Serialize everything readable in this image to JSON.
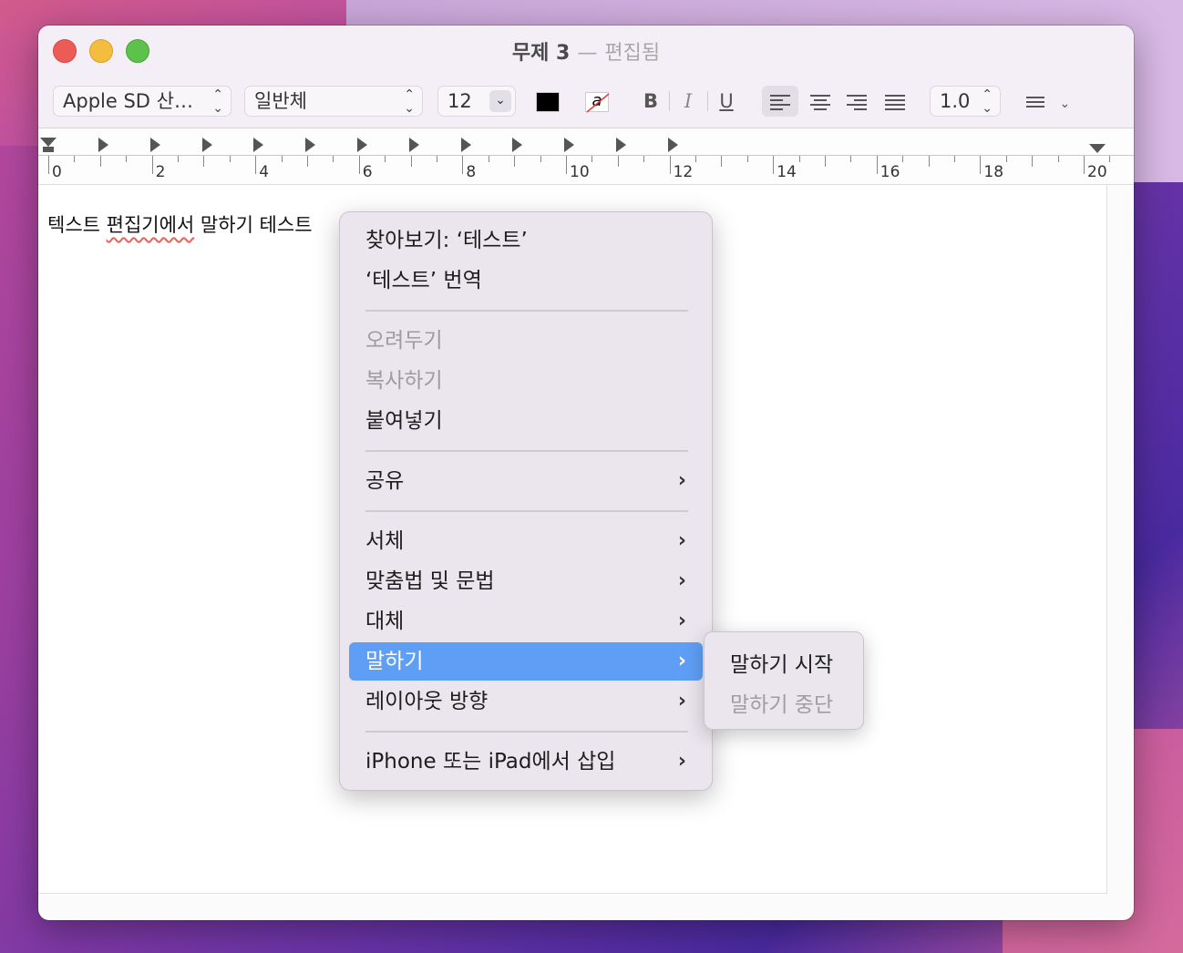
{
  "window": {
    "title": "무제 3",
    "title_sep": "—",
    "status": "편집됨"
  },
  "toolbar": {
    "font_family": "Apple SD 산…",
    "font_style": "일반체",
    "font_size": "12",
    "text_color": "#000000",
    "bold_label": "B",
    "italic_label": "I",
    "underline_label": "U",
    "line_spacing": "1.0",
    "bg_color_glyph": "a"
  },
  "ruler": {
    "labels": [
      "0",
      "2",
      "4",
      "6",
      "8",
      "10",
      "12",
      "14",
      "16",
      "18",
      "20"
    ]
  },
  "document": {
    "text_before": "텍스트 ",
    "text_squiggle": "편집기에서",
    "text_after": " 말하기 테스트"
  },
  "context_menu": {
    "items": [
      {
        "label": "찾아보기: ‘테스트’",
        "disabled": false
      },
      {
        "label": "‘테스트’ 번역",
        "disabled": false
      },
      {
        "label": "오려두기",
        "disabled": true
      },
      {
        "label": "복사하기",
        "disabled": true
      },
      {
        "label": "붙여넣기",
        "disabled": false
      },
      {
        "label": "공유",
        "submenu": true
      },
      {
        "label": "서체",
        "submenu": true
      },
      {
        "label": "맞춤법 및 문법",
        "submenu": true
      },
      {
        "label": "대체",
        "submenu": true
      },
      {
        "label": "말하기",
        "submenu": true,
        "highlighted": true
      },
      {
        "label": "레이아웃 방향",
        "submenu": true
      },
      {
        "label": "iPhone 또는 iPad에서 삽입",
        "submenu": true
      }
    ],
    "chevron": "›"
  },
  "speech_submenu": {
    "start": "말하기 시작",
    "stop": "말하기 중단"
  }
}
